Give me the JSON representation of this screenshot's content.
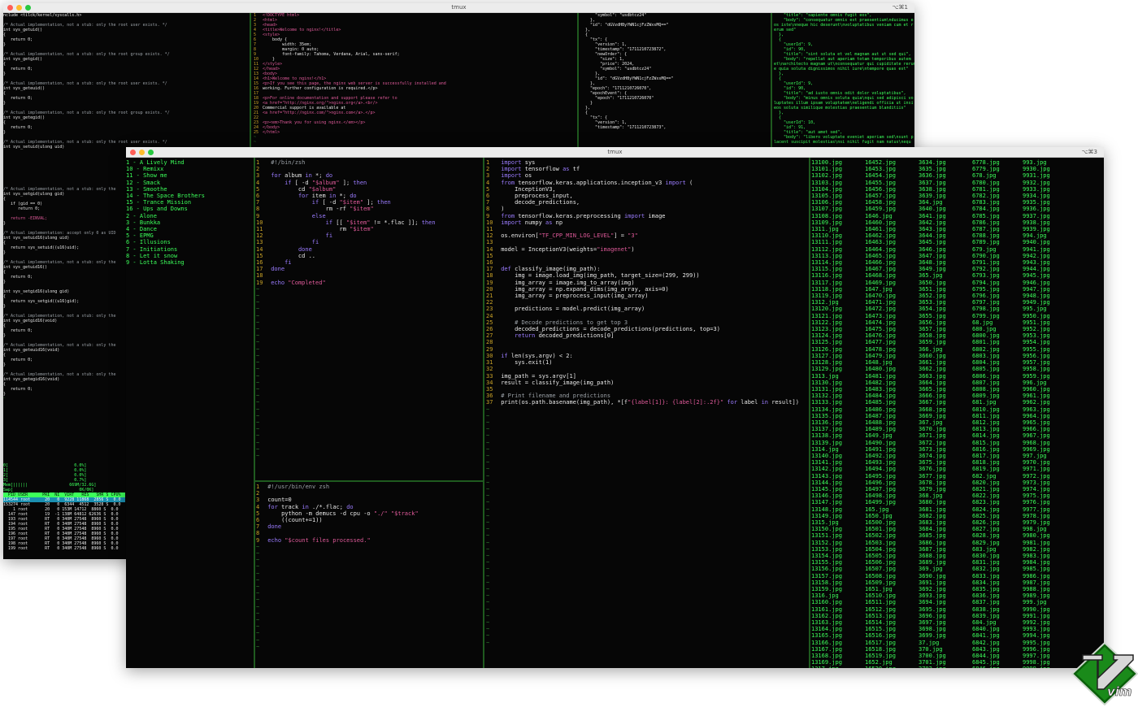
{
  "back_window": {
    "title": "tmux",
    "shortcut": "⌥⌘1",
    "syscalls_lines": [
      "nclude <tilck/kernel/syscalls.h>",
      "",
      "/* Actual implementation, not a stub: only the root user exists. */",
      "int sys_getuid()",
      "{",
      "   return 0;",
      "}",
      "",
      "/* Actual implementation, not a stub: only the root group exists. */",
      "int sys_getgid()",
      "{",
      "   return 0;",
      "}",
      "",
      "/* Actual implementation, not a stub: only the root user exists. */",
      "int sys_geteuid()",
      "{",
      "   return 0;",
      "}",
      "",
      "/* Actual implementation, not a stub: only the root group exists. */",
      "int sys_getegid()",
      "{",
      "   return 0;",
      "}",
      "",
      "/* Actual implementation, not a stub: only the root user exists. */",
      "int sys_setuid(ulong uid)",
      "{",
      "   if (uid == 0)",
      "      return 0;",
      "",
      "   return -EINVAL;",
      "}"
    ],
    "syscalls_lower_lines": [
      "/* Actual implementation, not a stub: only the",
      "int sys_setgid(ulong gid)",
      "{",
      "   if (gid == 0)",
      "      return 0;",
      "",
      "   return -EINVAL;",
      "}",
      "",
      "/* Actual implementation: accept only 0 as UID",
      "int sys_setuid16(ulong uid)",
      "{",
      "   return sys_setuid((u16)uid);",
      "}",
      "",
      "/* Actual implementation, not a stub: only the",
      "int sys_getuid16()",
      "{",
      "   return 0;",
      "}",
      "",
      "int sys_setgid16(ulong gid)",
      "{",
      "   return sys_setgid((u16)gid);",
      "}",
      "",
      "/* Actual implementation, not a stub: only the",
      "int sys_getgid16(void)",
      "{",
      "   return 0;",
      "}",
      "",
      "/* Actual implementation, not a stub: only the",
      "int sys_geteuid16(void)",
      "{",
      "   return 0;",
      "}",
      "",
      "/* Actual implementation, not a stub: only the",
      "int sys_getegid16(void)",
      "{",
      "   return 0;",
      "}"
    ],
    "html_lines": [
      "<!DOCTYPE html>",
      "<html>",
      "<head>",
      "<title>Welcome to nginx!</title>",
      "<style>",
      "    body {",
      "        width: 35em;",
      "        margin: 0 auto;",
      "        font-family: Tahoma, Verdana, Arial, sans-serif;",
      "    }",
      "</style>",
      "</head>",
      "<body>",
      "<h1>Welcome to nginx!</h1>",
      "<p>If you see this page, the nginx web server is successfully installed and",
      "working. Further configuration is required.</p>",
      "",
      "<p>For online documentation and support please refer to",
      "<a href=\"http://nginx.org/\">nginx.org</a>.<br/>",
      "Commercial support is available at",
      "<a href=\"http://nginx.com/\">nginx.com</a>.</p>",
      "",
      "<p><em>Thank you for using nginx.</em></p>",
      "</body>",
      "</html>"
    ],
    "json_lines": [
      "      \"symbol\": \"usdbtcz24\"",
      "    },",
      "    \"id\": \"dGVzdHByYWN1cjFzZWxsMQ==\"",
      "  },",
      "  {",
      "    \"tx\": {",
      "      \"version\": 1,",
      "      \"timestamp\": \"1711210723872\",",
      "      \"newOrder\": {",
      "        \"size\": 1,",
      "        \"price\": 2024,",
      "        \"symbol\": \"usdbtcz24\"",
      "      },",
      "      \"id\": \"dGVzdHByYWN1cjFzZWxsMQ==\"",
      "    },",
      "    \"epoch\": \"1711210726070\",",
      "    \"epochEvent\": {",
      "      \"epoch\": \"1711210726070\"",
      "    }",
      "  },",
      "  {",
      "    \"tx\": {",
      "      \"version\": 1,",
      "      \"timestamp\": \"1711210723873\","
    ],
    "posts_lines": [
      "    \"title\": \"sapiente omnis fugit eos\",",
      "    \"body\": \"consequatur omnis est praesentium\\nducimus e",
      "os iste\\nneque hic deserunt\\nvoluptatibus veniam cum et r",
      "erum sed\"",
      "  },",
      "  {",
      "    \"userId\": 9,",
      "    \"id\": 90,",
      "    \"title\": \"sint soluta et vel magnam aut ut sed qui\",",
      "    \"body\": \"repellat aut aperiam totam temporibus autem",
      "et\\narchitecto magnam ut\\nconsequatur qui cupiditate rerum",
      "e quia soluta dignissimos nihil iure\\ntempore quas est\"",
      "  },",
      "  {",
      "    \"userId\": 9,",
      "    \"id\": 90,",
      "    \"title\": \"ad iusto omnis odit dolor voluptatibus\",",
      "    \"body\": \"minus omnis soluta quia\\nqui sed adipisci vo",
      "luptates illum ipsam voluptatem\\neligendi officia ut insi",
      "eos soluta similique molestias praesentium blanditiis\"",
      "  },",
      "  {",
      "    \"userId\": 10,",
      "    \"id\": 91,",
      "    \"title\": \"aut amet sed\",",
      "    \"body\": \"libero voluptate eveniet aperiam sed\\nsunt p",
      "lacent suscipit molestias\\nsi nihil fugit nam natus\\nequ"
    ],
    "htop_lines": [
      "0[                           0.0%]",
      "1[                           0.0%]",
      "2[                           0.0%]",
      "3[                           0.7%]",
      "Mem[||||||                 669M/32.6G]",
      "Swp[                           0K/0K]"
    ],
    "htop_header": "  PID USER      PRI  NI  VIRT   RES   SHR S CPU%",
    "htop_rows": [
      "114544 root      20   0  9228 11868  2856 S  0.0",
      "153274 root      20   0  6344  4512  3528 S  0.0",
      "    1 root       20   0 153M 14712  8860 S  0.0",
      "  147 root       19  -1 138M 64812 62636 S  0.0",
      "  193 root       RT   0 340M 27548  8960 S  0.0",
      "  194 root       RT   0 340M 27548  8960 S  0.0",
      "  195 root       RT   0 340M 27548  8960 S  0.0",
      "  196 root       RT   0 340M 27548  8960 S  0.0",
      "  197 root       RT   0 340M 27548  8960 S  0.0",
      "  198 root       RT   0 340M 27548  8960 S  0.0",
      "  199 root       RT   0 340M 27548  8960 S  0.0"
    ]
  },
  "front_window": {
    "title": "tmux",
    "shortcut": "⌥⌘3",
    "playlist": [
      "1 - A Lively Mind",
      "10 - Remixx",
      "11 - Show me",
      "12 - Smack",
      "13 - Smoothe",
      "14 - The Space Brothers",
      "15 - Trance Mission",
      "16 - Ups and Downs",
      "2 - Alone",
      "3 - Bunkka",
      "4 - Dance",
      "5 - EPMG",
      "6 - Illusions",
      "7 - Initiations",
      "8 - Let it snow",
      "9 - Lotta Shaking"
    ],
    "zsh_script": [
      {
        "n": "1",
        "code": "#!/bin/zsh"
      },
      {
        "n": "2",
        "code": ""
      },
      {
        "n": "3",
        "code": "for album in *; do"
      },
      {
        "n": "4",
        "code": "    if [ -d \"$album\" ]; then"
      },
      {
        "n": "5",
        "code": "        cd \"$album\""
      },
      {
        "n": "6",
        "code": "        for item in *; do"
      },
      {
        "n": "7",
        "code": "            if [ -d \"$item\" ]; then"
      },
      {
        "n": "8",
        "code": "                rm -rf \"$item\""
      },
      {
        "n": "9",
        "code": "            else"
      },
      {
        "n": "10",
        "code": "                if [[ \"$item\" != *.flac ]]; then"
      },
      {
        "n": "11",
        "code": "                    rm \"$item\""
      },
      {
        "n": "12",
        "code": "                fi"
      },
      {
        "n": "13",
        "code": "            fi"
      },
      {
        "n": "14",
        "code": "        done"
      },
      {
        "n": "15",
        "code": "        cd .."
      },
      {
        "n": "16",
        "code": "    fi"
      },
      {
        "n": "17",
        "code": "done"
      },
      {
        "n": "18",
        "code": ""
      },
      {
        "n": "19",
        "code": "echo \"Completed\""
      }
    ],
    "demucs_script": [
      {
        "n": "1",
        "code": "#!/usr/bin/env zsh"
      },
      {
        "n": "2",
        "code": ""
      },
      {
        "n": "3",
        "code": "count=0"
      },
      {
        "n": "4",
        "code": "for track in ./*.flac; do"
      },
      {
        "n": "5",
        "code": "    python -m demucs -d cpu -o \"./\" \"$track\""
      },
      {
        "n": "6",
        "code": "    ((count+=1))"
      },
      {
        "n": "7",
        "code": "done"
      },
      {
        "n": "8",
        "code": ""
      },
      {
        "n": "9",
        "code": "echo \"$count files processed.\""
      }
    ],
    "python_script": [
      {
        "n": "1",
        "code": "import sys"
      },
      {
        "n": "2",
        "code": "import tensorflow as tf"
      },
      {
        "n": "3",
        "code": "import os"
      },
      {
        "n": "4",
        "code": "from tensorflow.keras.applications.inception_v3 import ("
      },
      {
        "n": "5",
        "code": "    InceptionV3,"
      },
      {
        "n": "6",
        "code": "    preprocess_input,"
      },
      {
        "n": "7",
        "code": "    decode_predictions,"
      },
      {
        "n": "8",
        "code": ")"
      },
      {
        "n": "9",
        "code": "from tensorflow.keras.preprocessing import image"
      },
      {
        "n": "10",
        "code": "import numpy as np"
      },
      {
        "n": "11",
        "code": ""
      },
      {
        "n": "12",
        "code": "os.environ[\"TF_CPP_MIN_LOG_LEVEL\"] = \"3\""
      },
      {
        "n": "13",
        "code": ""
      },
      {
        "n": "14",
        "code": "model = InceptionV3(weights=\"imagenet\")"
      },
      {
        "n": "15",
        "code": ""
      },
      {
        "n": "16",
        "code": ""
      },
      {
        "n": "17",
        "code": "def classify_image(img_path):"
      },
      {
        "n": "18",
        "code": "    img = image.load_img(img_path, target_size=(299, 299))"
      },
      {
        "n": "19",
        "code": "    img_array = image.img_to_array(img)"
      },
      {
        "n": "20",
        "code": "    img_array = np.expand_dims(img_array, axis=0)"
      },
      {
        "n": "21",
        "code": "    img_array = preprocess_input(img_array)"
      },
      {
        "n": "22",
        "code": ""
      },
      {
        "n": "23",
        "code": "    predictions = model.predict(img_array)"
      },
      {
        "n": "24",
        "code": ""
      },
      {
        "n": "25",
        "code": "    # Decode predictions to get top 3"
      },
      {
        "n": "26",
        "code": "    decoded_predictions = decode_predictions(predictions, top=3)"
      },
      {
        "n": "27",
        "code": "    return decoded_predictions[0]"
      },
      {
        "n": "28",
        "code": ""
      },
      {
        "n": "29",
        "code": ""
      },
      {
        "n": "30",
        "code": "if len(sys.argv) < 2:"
      },
      {
        "n": "31",
        "code": "    sys.exit(1)"
      },
      {
        "n": "32",
        "code": ""
      },
      {
        "n": "33",
        "code": "img_path = sys.argv[1]"
      },
      {
        "n": "34",
        "code": "result = classify_image(img_path)"
      },
      {
        "n": "35",
        "code": ""
      },
      {
        "n": "36",
        "code": "# Print filename and predictions"
      },
      {
        "n": "37",
        "code": "print(os.path.basename(img_path), *[f\"{label[1]}: {label[2]:.2f}\" for label in result])"
      }
    ],
    "file_columns": [
      [
        "13100.jpg",
        "13101.jpg",
        "13102.jpg",
        "13103.jpg",
        "13104.jpg",
        "13105.jpg",
        "13106.jpg",
        "13107.jpg",
        "13108.jpg",
        "13109.jpg",
        "1311.jpg",
        "13110.jpg",
        "13111.jpg",
        "13112.jpg",
        "13113.jpg",
        "13114.jpg",
        "13115.jpg",
        "13116.jpg",
        "13117.jpg",
        "13118.jpg",
        "13119.jpg",
        "1312.jpg",
        "13120.jpg",
        "13121.jpg",
        "13122.jpg",
        "13123.jpg",
        "13124.jpg",
        "13125.jpg",
        "13126.jpg",
        "13127.jpg",
        "13128.jpg",
        "13129.jpg",
        "1313.jpg",
        "13130.jpg",
        "13131.jpg",
        "13132.jpg",
        "13133.jpg",
        "13134.jpg",
        "13135.jpg",
        "13136.jpg",
        "13137.jpg",
        "13138.jpg",
        "13139.jpg",
        "1314.jpg",
        "13140.jpg",
        "13141.jpg",
        "13142.jpg",
        "13143.jpg",
        "13144.jpg",
        "13145.jpg",
        "13146.jpg",
        "13147.jpg",
        "13148.jpg",
        "13149.jpg",
        "1315.jpg",
        "13150.jpg",
        "13151.jpg",
        "13152.jpg",
        "13153.jpg",
        "13154.jpg",
        "13155.jpg",
        "13156.jpg",
        "13157.jpg",
        "13158.jpg",
        "13159.jpg",
        "1316.jpg",
        "13160.jpg",
        "13161.jpg",
        "13162.jpg",
        "13163.jpg",
        "13164.jpg",
        "13165.jpg",
        "13166.jpg",
        "13167.jpg",
        "13168.jpg",
        "13169.jpg",
        "1317.jpg",
        "13170.jpg",
        "13171.jpg"
      ],
      [
        "16452.jpg",
        "16453.jpg",
        "16454.jpg",
        "16455.jpg",
        "16456.jpg",
        "16457.jpg",
        "16458.jpg",
        "16459.jpg",
        "1646.jpg",
        "16460.jpg",
        "16461.jpg",
        "16462.jpg",
        "16463.jpg",
        "16464.jpg",
        "16465.jpg",
        "16466.jpg",
        "16467.jpg",
        "16468.jpg",
        "16469.jpg",
        "1647.jpg",
        "16470.jpg",
        "16471.jpg",
        "16472.jpg",
        "16473.jpg",
        "16474.jpg",
        "16475.jpg",
        "16476.jpg",
        "16477.jpg",
        "16478.jpg",
        "16479.jpg",
        "1648.jpg",
        "16480.jpg",
        "16481.jpg",
        "16482.jpg",
        "16483.jpg",
        "16484.jpg",
        "16485.jpg",
        "16486.jpg",
        "16487.jpg",
        "16488.jpg",
        "16489.jpg",
        "1649.jpg",
        "16490.jpg",
        "16491.jpg",
        "16492.jpg",
        "16493.jpg",
        "16494.jpg",
        "16495.jpg",
        "16496.jpg",
        "16497.jpg",
        "16498.jpg",
        "16499.jpg",
        "165.jpg",
        "1650.jpg",
        "16500.jpg",
        "16501.jpg",
        "16502.jpg",
        "16503.jpg",
        "16504.jpg",
        "16505.jpg",
        "16506.jpg",
        "16507.jpg",
        "16508.jpg",
        "16509.jpg",
        "1651.jpg",
        "16510.jpg",
        "16511.jpg",
        "16512.jpg",
        "16513.jpg",
        "16514.jpg",
        "16515.jpg",
        "16516.jpg",
        "16517.jpg",
        "16518.jpg",
        "16519.jpg",
        "1652.jpg",
        "16520.jpg",
        "16521.jpg"
      ],
      [
        "3634.jpg",
        "3635.jpg",
        "3636.jpg",
        "3637.jpg",
        "3638.jpg",
        "3639.jpg",
        "364.jpg",
        "3640.jpg",
        "3641.jpg",
        "3642.jpg",
        "3643.jpg",
        "3644.jpg",
        "3645.jpg",
        "3646.jpg",
        "3647.jpg",
        "3648.jpg",
        "3649.jpg",
        "365.jpg",
        "3650.jpg",
        "3651.jpg",
        "3652.jpg",
        "3653.jpg",
        "3654.jpg",
        "3655.jpg",
        "3656.jpg",
        "3657.jpg",
        "3658.jpg",
        "3659.jpg",
        "366.jpg",
        "3660.jpg",
        "3661.jpg",
        "3662.jpg",
        "3663.jpg",
        "3664.jpg",
        "3665.jpg",
        "3666.jpg",
        "3667.jpg",
        "3668.jpg",
        "3669.jpg",
        "367.jpg",
        "3670.jpg",
        "3671.jpg",
        "3672.jpg",
        "3673.jpg",
        "3674.jpg",
        "3675.jpg",
        "3676.jpg",
        "3677.jpg",
        "3678.jpg",
        "3679.jpg",
        "368.jpg",
        "3680.jpg",
        "3681.jpg",
        "3682.jpg",
        "3683.jpg",
        "3684.jpg",
        "3685.jpg",
        "3686.jpg",
        "3687.jpg",
        "3688.jpg",
        "3689.jpg",
        "369.jpg",
        "3690.jpg",
        "3691.jpg",
        "3692.jpg",
        "3693.jpg",
        "3694.jpg",
        "3695.jpg",
        "3696.jpg",
        "3697.jpg",
        "3698.jpg",
        "3699.jpg",
        "37.jpg",
        "370.jpg",
        "3700.jpg",
        "3701.jpg",
        "3702.jpg"
      ],
      [
        "6778.jpg",
        "6779.jpg",
        "678.jpg",
        "6780.jpg",
        "6781.jpg",
        "6782.jpg",
        "6783.jpg",
        "6784.jpg",
        "6785.jpg",
        "6786.jpg",
        "6787.jpg",
        "6788.jpg",
        "6789.jpg",
        "679.jpg",
        "6790.jpg",
        "6791.jpg",
        "6792.jpg",
        "6793.jpg",
        "6794.jpg",
        "6795.jpg",
        "6796.jpg",
        "6797.jpg",
        "6798.jpg",
        "6799.jpg",
        "68.jpg",
        "680.jpg",
        "6800.jpg",
        "6801.jpg",
        "6802.jpg",
        "6803.jpg",
        "6804.jpg",
        "6805.jpg",
        "6806.jpg",
        "6807.jpg",
        "6808.jpg",
        "6809.jpg",
        "681.jpg",
        "6810.jpg",
        "6811.jpg",
        "6812.jpg",
        "6813.jpg",
        "6814.jpg",
        "6815.jpg",
        "6816.jpg",
        "6817.jpg",
        "6818.jpg",
        "6819.jpg",
        "682.jpg",
        "6820.jpg",
        "6821.jpg",
        "6822.jpg",
        "6823.jpg",
        "6824.jpg",
        "6825.jpg",
        "6826.jpg",
        "6827.jpg",
        "6828.jpg",
        "6829.jpg",
        "683.jpg",
        "6830.jpg",
        "6831.jpg",
        "6832.jpg",
        "6833.jpg",
        "6834.jpg",
        "6835.jpg",
        "6836.jpg",
        "6837.jpg",
        "6838.jpg",
        "6839.jpg",
        "684.jpg",
        "6840.jpg",
        "6841.jpg",
        "6842.jpg",
        "6843.jpg",
        "6844.jpg",
        "6845.jpg",
        "6846.jpg",
        "6847.jpg",
        "6848.jpg",
        "6849.jpg"
      ],
      [
        "993.jpg",
        "9930.jpg",
        "9931.jpg",
        "9932.jpg",
        "9933.jpg",
        "9934.jpg",
        "9935.jpg",
        "9936.jpg",
        "9937.jpg",
        "9938.jpg",
        "9939.jpg",
        "994.jpg",
        "9940.jpg",
        "9941.jpg",
        "9942.jpg",
        "9943.jpg",
        "9944.jpg",
        "9945.jpg",
        "9946.jpg",
        "9947.jpg",
        "9948.jpg",
        "9949.jpg",
        "995.jpg",
        "9950.jpg",
        "9951.jpg",
        "9952.jpg",
        "9953.jpg",
        "9954.jpg",
        "9955.jpg",
        "9956.jpg",
        "9957.jpg",
        "9958.jpg",
        "9959.jpg",
        "996.jpg",
        "9960.jpg",
        "9961.jpg",
        "9962.jpg",
        "9963.jpg",
        "9964.jpg",
        "9965.jpg",
        "9966.jpg",
        "9967.jpg",
        "9968.jpg",
        "9969.jpg",
        "997.jpg",
        "9970.jpg",
        "9971.jpg",
        "9972.jpg",
        "9973.jpg",
        "9974.jpg",
        "9975.jpg",
        "9976.jpg",
        "9977.jpg",
        "9978.jpg",
        "9979.jpg",
        "998.jpg",
        "9980.jpg",
        "9981.jpg",
        "9982.jpg",
        "9983.jpg",
        "9984.jpg",
        "9985.jpg",
        "9986.jpg",
        "9987.jpg",
        "9988.jpg",
        "9989.jpg",
        "999.jpg",
        "9990.jpg",
        "9991.jpg",
        "9992.jpg",
        "9993.jpg",
        "9994.jpg",
        "9995.jpg",
        "9996.jpg",
        "9997.jpg",
        "9998.jpg",
        "9999.jpg"
      ]
    ],
    "prompt_glyph": "▶"
  },
  "logo": {
    "name": "vim-logo",
    "text": "vim"
  },
  "colors": {
    "accent_green": "#3cff5a",
    "line_number": "#c9a227",
    "keyword": "#9b7cff",
    "string": "#e05a9a",
    "titlebar": "#ececec"
  }
}
